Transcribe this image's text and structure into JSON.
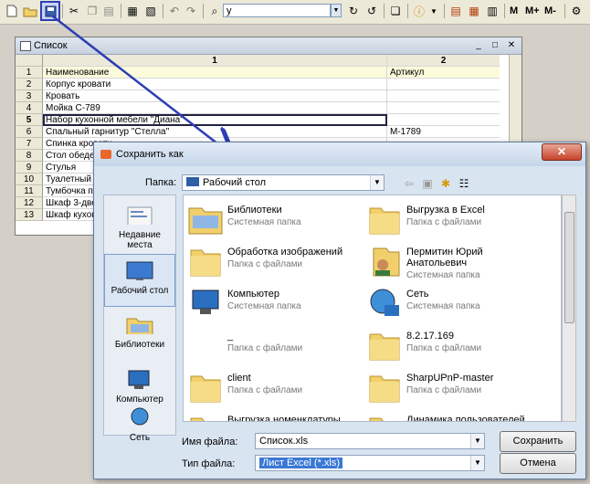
{
  "toolbar": {
    "search_value": "у",
    "m_label": "M",
    "mplus_label": "M+",
    "mminus_label": "M-"
  },
  "list_window": {
    "title": "Список",
    "col1_header": "1",
    "col2_header": "2",
    "rows": [
      {
        "num": "1",
        "name": "Наименование",
        "art": "Артикул"
      },
      {
        "num": "2",
        "name": "Корпус кровати",
        "art": ""
      },
      {
        "num": "3",
        "name": "Кровать",
        "art": ""
      },
      {
        "num": "4",
        "name": "Мойка С-789",
        "art": ""
      },
      {
        "num": "5",
        "name": "Набор кухонной мебели \"Диана\"",
        "art": ""
      },
      {
        "num": "6",
        "name": "Спальный гарнитур \"Стелла\"",
        "art": "М-1789"
      },
      {
        "num": "7",
        "name": "Спинка кровати",
        "art": ""
      },
      {
        "num": "8",
        "name": "Стол обеденный",
        "art": ""
      },
      {
        "num": "9",
        "name": "Стулья",
        "art": ""
      },
      {
        "num": "10",
        "name": "Туалетный",
        "art": ""
      },
      {
        "num": "11",
        "name": "Тумбочка п",
        "art": ""
      },
      {
        "num": "12",
        "name": "Шкаф 3-две",
        "art": ""
      },
      {
        "num": "13",
        "name": "Шкаф кухон",
        "art": ""
      }
    ]
  },
  "save_dialog": {
    "title": "Сохранить как",
    "folder_label": "Папка:",
    "folder_value": "Рабочий стол",
    "places": [
      {
        "label1": "Недавние",
        "label2": "места"
      },
      {
        "label1": "Рабочий стол",
        "label2": ""
      },
      {
        "label1": "Библиотеки",
        "label2": ""
      },
      {
        "label1": "Компьютер",
        "label2": ""
      },
      {
        "label1": "Сеть",
        "label2": ""
      }
    ],
    "files": [
      {
        "name": "Библиотеки",
        "name2": "",
        "sub": "Системная папка"
      },
      {
        "name": "Выгрузка в Excel",
        "name2": "",
        "sub": "Папка с файлами"
      },
      {
        "name": "Обработка изображений",
        "name2": "",
        "sub": "Папка с файлами"
      },
      {
        "name": "Пермитин Юрий",
        "name2": "Анатольевич",
        "sub": "Системная папка"
      },
      {
        "name": "Компьютер",
        "name2": "",
        "sub": "Системная папка"
      },
      {
        "name": "Сеть",
        "name2": "",
        "sub": "Системная папка"
      },
      {
        "name": "_",
        "name2": "",
        "sub": "Папка с файлами"
      },
      {
        "name": "8.2.17.169",
        "name2": "",
        "sub": "Папка с файлами"
      },
      {
        "name": "client",
        "name2": "",
        "sub": "Папка с файлами"
      },
      {
        "name": "SharpUPnP-master",
        "name2": "",
        "sub": "Папка с файлами"
      },
      {
        "name": "Выгрузка номенклатуры",
        "name2": "",
        "sub": ""
      },
      {
        "name": "Динамика пользователей",
        "name2": "",
        "sub": ""
      }
    ],
    "filename_label": "Имя файла:",
    "filename_value": "Список.xls",
    "filetype_label": "Тип файла:",
    "filetype_value": "Лист Excel (*.xls)",
    "save_button": "Сохранить",
    "cancel_button": "Отмена"
  },
  "colors": {
    "arrow": "#2d3eb4",
    "folder": "#f1cf6a",
    "filetype_highlight": "#3a78d6"
  }
}
